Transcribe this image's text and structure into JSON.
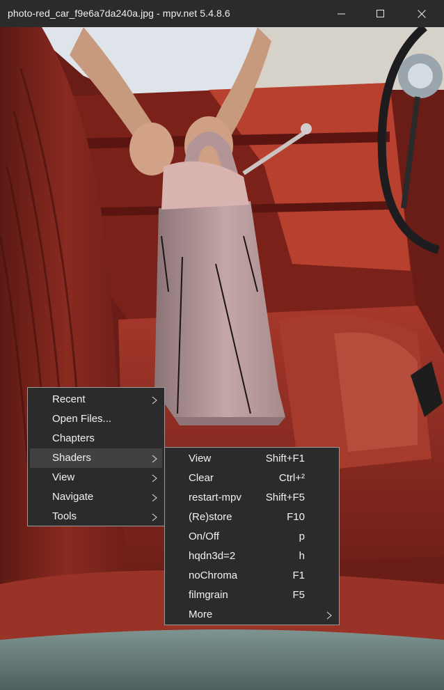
{
  "window": {
    "title": "photo-red_car_f9e6a7da240a.jpg - mpv.net 5.4.8.6"
  },
  "context_menu": {
    "items": [
      {
        "label": "Recent",
        "has_submenu": true
      },
      {
        "label": "Open Files...",
        "has_submenu": false
      },
      {
        "label": "Chapters",
        "has_submenu": false
      },
      {
        "label": "Shaders",
        "has_submenu": true,
        "active": true
      },
      {
        "label": "View",
        "has_submenu": true
      },
      {
        "label": "Navigate",
        "has_submenu": true
      },
      {
        "label": "Tools",
        "has_submenu": true
      }
    ]
  },
  "shaders_submenu": {
    "items": [
      {
        "label": "View",
        "shortcut": "Shift+F1"
      },
      {
        "label": "Clear",
        "shortcut": "Ctrl+²"
      },
      {
        "label": "restart-mpv",
        "shortcut": "Shift+F5"
      },
      {
        "label": "(Re)store",
        "shortcut": "F10"
      },
      {
        "label": "On/Off",
        "shortcut": "p"
      },
      {
        "label": "hqdn3d=2",
        "shortcut": "h"
      },
      {
        "label": "noChroma",
        "shortcut": "F1"
      },
      {
        "label": "filmgrain",
        "shortcut": "F5"
      },
      {
        "label": "More",
        "shortcut": "",
        "has_submenu": true
      }
    ]
  },
  "colors": {
    "titlebar_bg": "#2b2b2b",
    "menu_bg": "#2b2b2b",
    "menu_border": "#9a9a9a",
    "menu_highlight": "#414141",
    "menu_text": "#f2f2f2",
    "leather_red": "#8e2a22"
  },
  "icons": {
    "minimize": "minimize-icon",
    "maximize": "maximize-icon",
    "close": "close-icon",
    "submenu": "chevron-right-icon"
  }
}
